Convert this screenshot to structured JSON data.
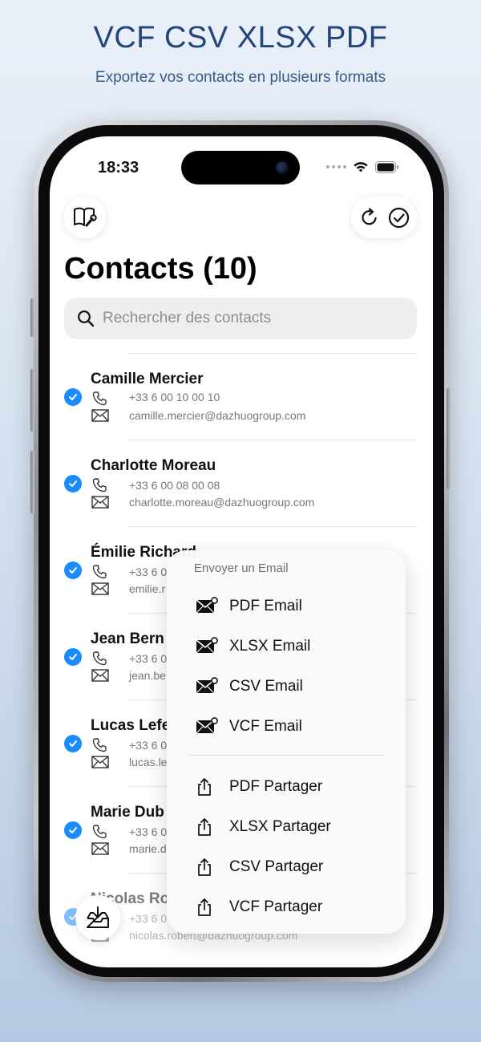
{
  "promo": {
    "title": "VCF CSV XLSX PDF",
    "subtitle": "Exportez vos contacts en plusieurs formats"
  },
  "status_bar": {
    "time": "18:33"
  },
  "header": {
    "left_button_icon": "book-wrench-icon",
    "refresh_icon": "refresh-icon",
    "select_all_icon": "check-circle-icon",
    "title": "Contacts (10)"
  },
  "search": {
    "placeholder": "Rechercher des contacts",
    "value": ""
  },
  "contacts": [
    {
      "name": "Camille Mercier",
      "phone": "+33 6 00 10 00 10",
      "email": "camille.mercier@dazhuogroup.com",
      "selected": true
    },
    {
      "name": "Charlotte Moreau",
      "phone": "+33 6 00 08 00 08",
      "email": "charlotte.moreau@dazhuogroup.com",
      "selected": true
    },
    {
      "name": "Émilie Richard",
      "phone": "+33 6 0",
      "email": "emilie.r",
      "selected": true
    },
    {
      "name": "Jean Bern",
      "phone": "+33 6 0",
      "email": "jean.be",
      "selected": true
    },
    {
      "name": "Lucas Lefe",
      "phone": "+33 6 0",
      "email": "lucas.le",
      "selected": true
    },
    {
      "name": "Marie Dub",
      "phone": "+33 6 0",
      "email": "marie.d",
      "selected": true
    },
    {
      "name": "Nicolas Ro",
      "phone": "+33 6 0",
      "email": "nicolas.robert@dazhuogroup.com",
      "selected": true
    }
  ],
  "menu": {
    "header": "Envoyer un Email",
    "email_items": [
      {
        "label": "PDF Email",
        "icon": "mail-badge-icon"
      },
      {
        "label": "XLSX Email",
        "icon": "mail-badge-icon"
      },
      {
        "label": "CSV Email",
        "icon": "mail-badge-icon"
      },
      {
        "label": "VCF Email",
        "icon": "mail-badge-icon"
      }
    ],
    "share_items": [
      {
        "label": "PDF Partager",
        "icon": "share-icon"
      },
      {
        "label": "XLSX Partager",
        "icon": "share-icon"
      },
      {
        "label": "CSV Partager",
        "icon": "share-icon"
      },
      {
        "label": "VCF Partager",
        "icon": "share-icon"
      }
    ]
  },
  "colors": {
    "accent": "#1a8cff",
    "promo_title": "#23467a"
  }
}
